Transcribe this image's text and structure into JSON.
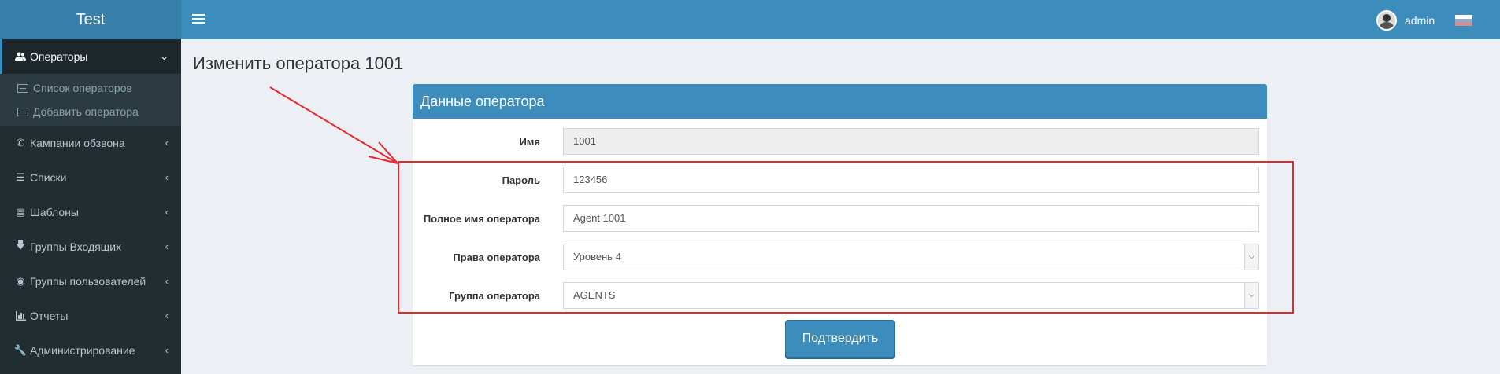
{
  "header": {
    "logo": "Test",
    "user_name": "admin",
    "flag_colors": [
      "#ffffff",
      "#1c57a7",
      "#d52b1e"
    ]
  },
  "sidebar": {
    "items": [
      {
        "label": "Операторы",
        "icon": "users-icon",
        "active": true
      },
      {
        "label": "Кампании обзвона",
        "icon": "phone-icon"
      },
      {
        "label": "Списки",
        "icon": "list-icon"
      },
      {
        "label": "Шаблоны",
        "icon": "file-icon"
      },
      {
        "label": "Группы Входящих",
        "icon": "arrow-down-icon"
      },
      {
        "label": "Группы пользователей",
        "icon": "user-circle-icon"
      },
      {
        "label": "Отчеты",
        "icon": "bar-chart-icon"
      },
      {
        "label": "Администрирование",
        "icon": "wrench-icon"
      }
    ],
    "submenu": [
      {
        "label": "Список операторов",
        "icon": "list-alt-icon"
      },
      {
        "label": "Добавить оператора",
        "icon": "id-card-icon"
      }
    ]
  },
  "page": {
    "title": "Изменить оператора 1001"
  },
  "form": {
    "title": "Данные оператора",
    "fields": [
      {
        "label": "Имя",
        "value": "1001",
        "readonly": true
      },
      {
        "label": "Пароль",
        "value": "123456"
      },
      {
        "label": "Полное имя оператора",
        "value": "Agent 1001"
      },
      {
        "label": "Права оператора",
        "value": "Уровень 4",
        "type": "select"
      },
      {
        "label": "Группа оператора",
        "value": "AGENTS",
        "type": "select"
      }
    ],
    "submit_label": "Подтвердить"
  },
  "colors": {
    "header": "#3c8dbc",
    "sidebar": "#222d32",
    "annotation": "#e8262b"
  }
}
